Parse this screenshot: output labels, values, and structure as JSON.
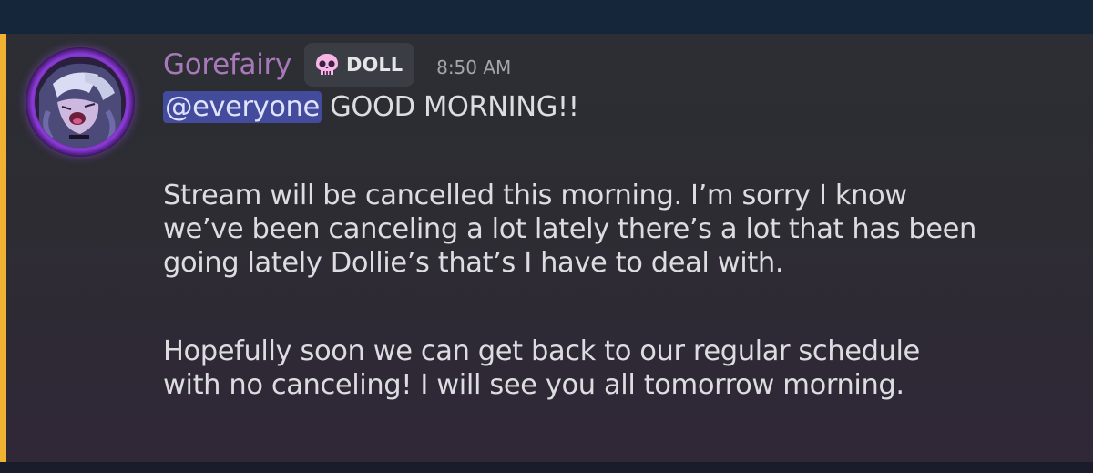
{
  "message": {
    "author": "Gorefairy",
    "role_tag": {
      "icon": "skull-icon",
      "label": "DOLL"
    },
    "timestamp": "8:50 AM",
    "mention": "@everyone",
    "line1_rest": " GOOD MORNING!!",
    "paragraph2": [
      "Stream will be cancelled this morning. I’m sorry I know",
      "we’ve been canceling a lot lately there’s a lot that has been",
      "going lately Dollie’s that’s I have to deal with."
    ],
    "paragraph3": [
      "Hopefully soon we can get back to our regular schedule",
      "with no canceling! I will see you all tomorrow morning."
    ]
  },
  "colors": {
    "username": "#a779b9",
    "mention_highlight_bar": "#f0b232",
    "mention_background": "#5865f2",
    "avatar_ring": "#8c3ad8"
  }
}
